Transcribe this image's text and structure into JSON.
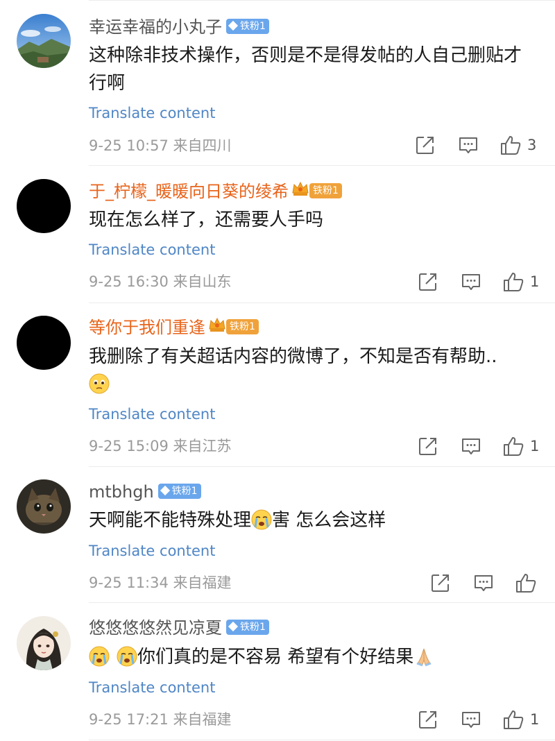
{
  "comments": [
    {
      "username": "幸运幸福的小丸子",
      "badge": "铁粉1",
      "text": "这种除非技术操作，否则是不是得发帖的人自己删贴才行啊",
      "translate": "Translate content",
      "time": "9-25 10:57",
      "location": "来自四川",
      "likes": "3"
    },
    {
      "username": "于_柠檬_暖暖向日葵的绫希",
      "badge": "铁粉1",
      "text": "现在怎么样了，还需要人手吗",
      "translate": "Translate content",
      "time": "9-25 16:30",
      "location": "来自山东",
      "likes": "1"
    },
    {
      "username": "等你于我们重逢",
      "badge": "铁粉1",
      "text": "我删除了有关超话内容的微博了，不知是否有帮助..",
      "translate": "Translate content",
      "time": "9-25 15:09",
      "location": "来自江苏",
      "likes": "1"
    },
    {
      "username": "mtbhgh",
      "badge": "铁粉1",
      "text_part1": "天啊能不能特殊处理",
      "text_part2": "害 怎么会这样",
      "translate": "Translate content",
      "time": "9-25 11:34",
      "location": "来自福建",
      "likes": ""
    },
    {
      "username": "悠悠悠悠然见凉夏",
      "badge": "铁粉1",
      "text": "你们真的是不容易 希望有个好结果",
      "translate": "Translate content",
      "time": "9-25 17:21",
      "location": "来自福建",
      "likes": "1"
    }
  ],
  "icons": {
    "share": "share-icon",
    "comment": "comment-icon",
    "like": "like-icon"
  },
  "colors": {
    "link": "#4f86c6",
    "orange_name": "#e8641b",
    "blue_badge": "#6aa6ec",
    "gold_badge": "#f0a23a"
  }
}
